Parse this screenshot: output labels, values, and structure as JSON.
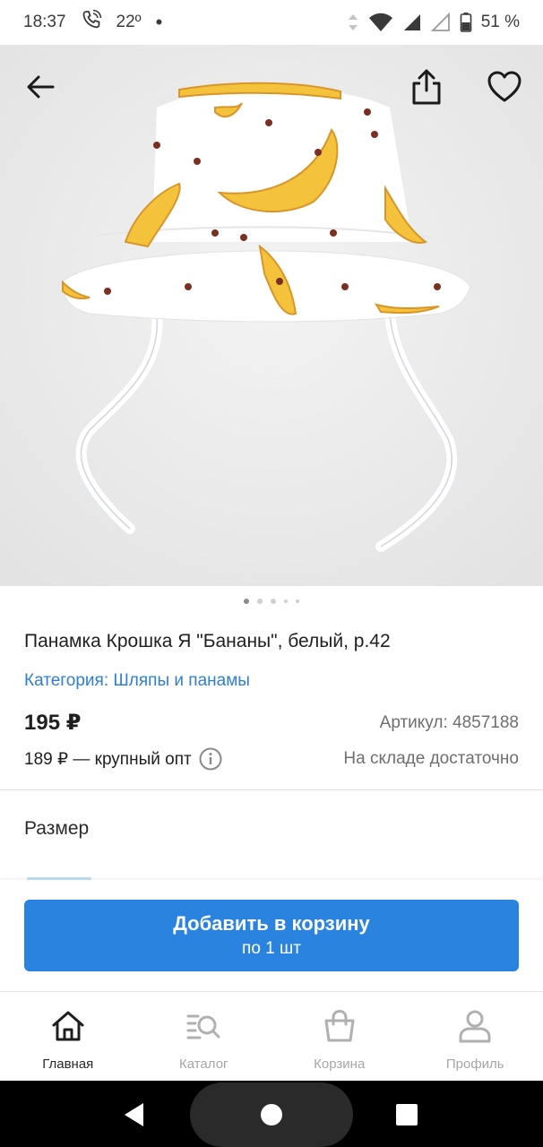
{
  "status_bar": {
    "time": "18:37",
    "temperature": "22º",
    "battery": "51 %"
  },
  "hero": {
    "image_alt": "Панамка Крошка Я Бананы",
    "dots_count": 5,
    "active_dot": 0
  },
  "product": {
    "title": "Панамка Крошка Я \"Бананы\", белый, р.42",
    "category": "Категория: Шляпы и панамы",
    "price": "195 ₽",
    "article": "Артикул: 4857188",
    "wholesale": "189 ₽ — крупный опт",
    "stock": "На складе достаточно"
  },
  "size_section": {
    "label": "Размер"
  },
  "cart_button": {
    "main": "Добавить в корзину",
    "sub": "по 1 шт"
  },
  "bottom_nav": [
    {
      "label": "Главная",
      "icon": "home-icon",
      "active": true
    },
    {
      "label": "Каталог",
      "icon": "catalog-icon",
      "active": false
    },
    {
      "label": "Корзина",
      "icon": "cart-icon",
      "active": false
    },
    {
      "label": "Профиль",
      "icon": "profile-icon",
      "active": false
    }
  ],
  "colors": {
    "accent": "#2a84df",
    "link": "#2f7fcf",
    "muted": "#6f6f6f"
  }
}
